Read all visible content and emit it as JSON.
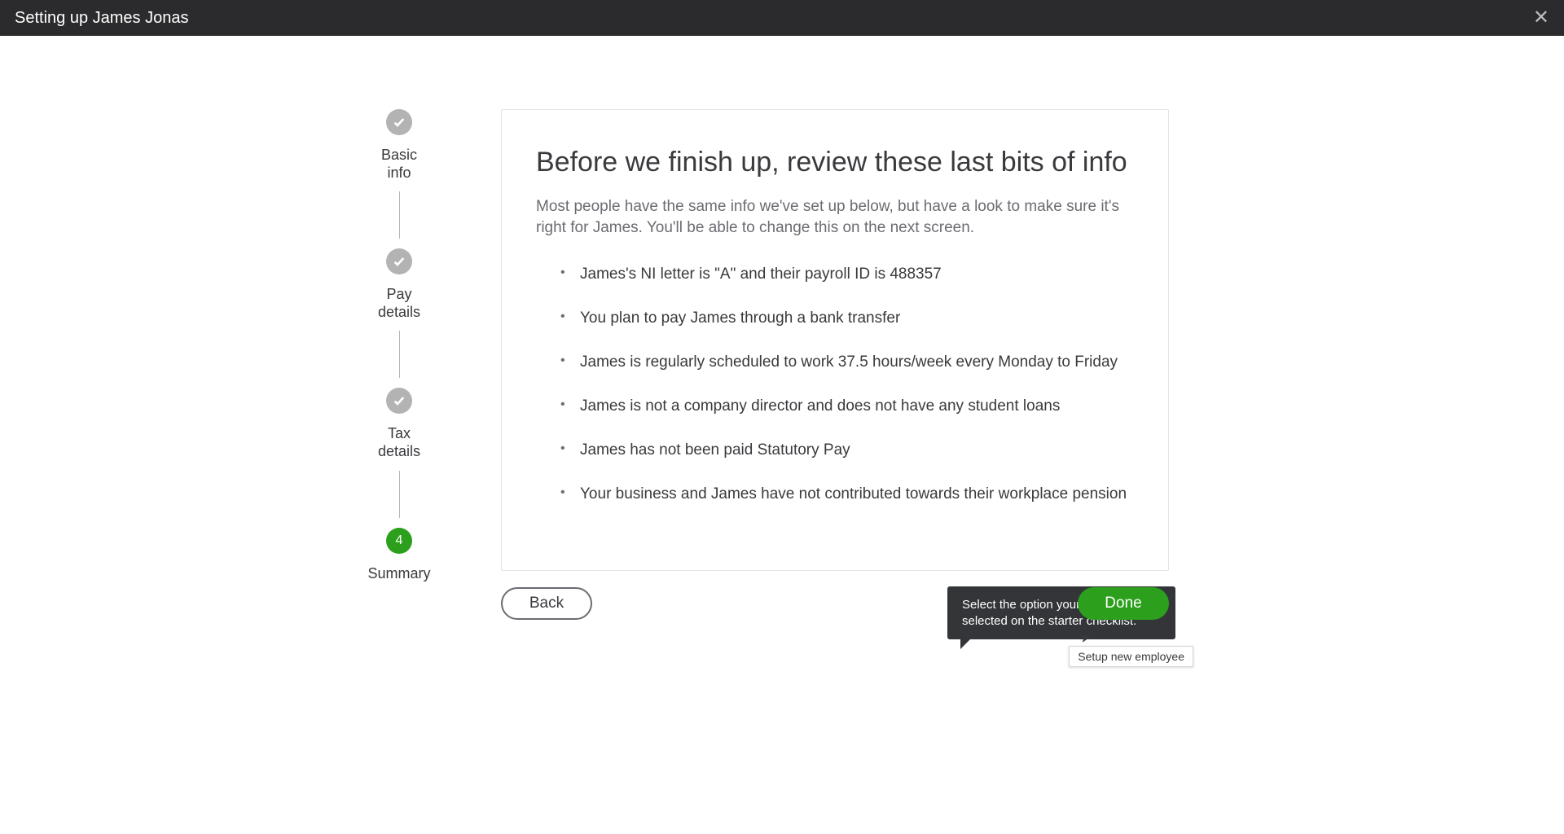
{
  "header": {
    "title": "Setting up James Jonas"
  },
  "stepper": {
    "steps": [
      {
        "label": "Basic\ninfo",
        "state": "done"
      },
      {
        "label": "Pay\ndetails",
        "state": "done"
      },
      {
        "label": "Tax\ndetails",
        "state": "done"
      },
      {
        "label": "Summary",
        "state": "active",
        "number": "4"
      }
    ]
  },
  "card": {
    "heading": "Before we finish up, review these last bits of info",
    "description": "Most people have the same info we've set up below, but have a look to make sure it's right for James. You'll be able to change this on the next screen.",
    "bullets": [
      "James's NI letter is \"A\" and their payroll ID is 488357",
      "You plan to pay James through a bank transfer",
      "James is regularly scheduled to work 37.5 hours/week every Monday to Friday",
      "James is not a company director and does not have any student loans",
      "James has not been paid Statutory Pay",
      "Your business and James have not contributed towards their workplace pension"
    ]
  },
  "tooltip": {
    "text": "Select the option your employee selected on the starter checklist."
  },
  "buttons": {
    "back": "Back",
    "done": "Done"
  },
  "hover": {
    "label": "Setup new employee"
  }
}
